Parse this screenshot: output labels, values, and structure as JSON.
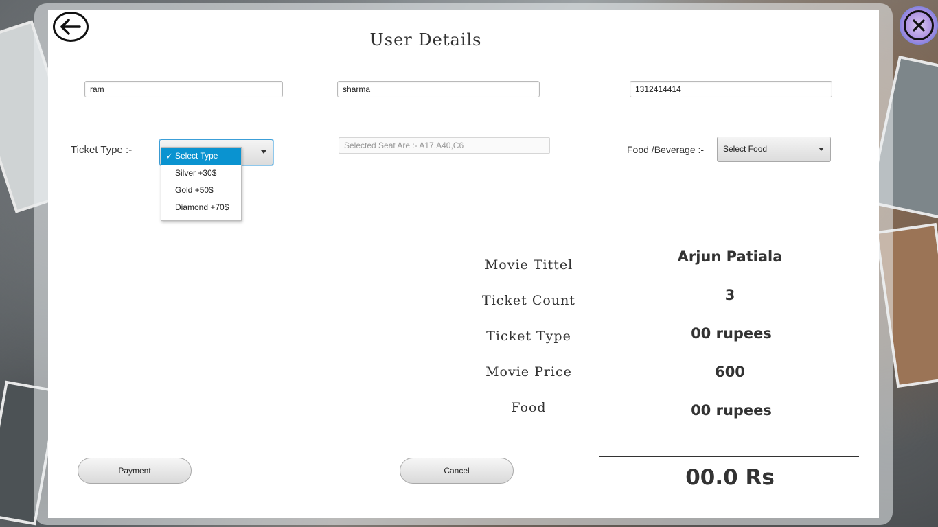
{
  "header": {
    "title": "User Details"
  },
  "form": {
    "first_name": "ram",
    "last_name": "sharma",
    "phone": "1312414414",
    "ticket_type_label": "Ticket Type  :-",
    "ticket_type_options": [
      "Select Type",
      "Silver  +30$",
      "Gold  +50$",
      "Diamond  +70$"
    ],
    "ticket_type_selected": "Select Type",
    "selected_seats": "Selected Seat Are :- A17,A40,C6",
    "food_label": "Food /Beverage :-",
    "food_selected": "Select Food"
  },
  "summary": {
    "rows": [
      {
        "label": "Movie Tittel",
        "value": "Arjun Patiala"
      },
      {
        "label": "Ticket Count",
        "value": "3"
      },
      {
        "label": "Ticket Type",
        "value": "00 rupees"
      },
      {
        "label": "Movie Price",
        "value": "600"
      },
      {
        "label": "Food",
        "value": "00 rupees"
      }
    ],
    "total": "00.0 Rs"
  },
  "actions": {
    "payment_label": "Payment",
    "cancel_label": "Cancel"
  },
  "icons": {
    "back": "arrow-left-circle-icon",
    "close": "close-circle-icon"
  },
  "colors": {
    "selection_highlight": "#0a93d0",
    "focus_border": "#3c9fd8"
  }
}
